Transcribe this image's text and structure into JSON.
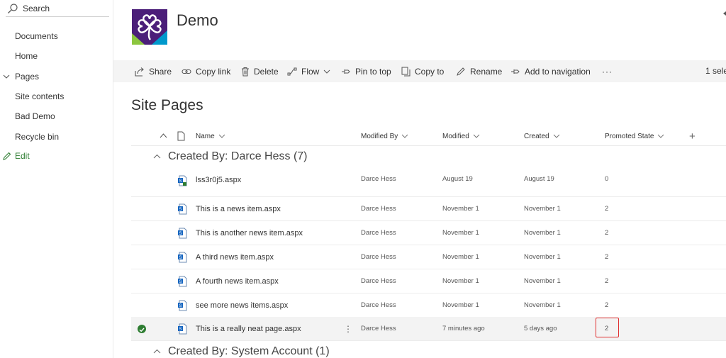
{
  "nav": {
    "search_label": "Search",
    "items": [
      "Documents",
      "Home",
      "Pages",
      "Site contents",
      "Bad Demo",
      "Recycle bin"
    ],
    "edit_label": "Edit"
  },
  "site": {
    "title": "Demo"
  },
  "command_bar": {
    "share": "Share",
    "copy_link": "Copy link",
    "delete": "Delete",
    "flow": "Flow",
    "pin_to_top": "Pin to top",
    "copy_to": "Copy to",
    "rename": "Rename",
    "add_to_navigation": "Add to navigation",
    "more": "···",
    "selection_text": "1 sele"
  },
  "page_title": "Site Pages",
  "columns": {
    "name": "Name",
    "modified_by": "Modified By",
    "modified": "Modified",
    "created": "Created",
    "promoted_state": "Promoted State",
    "add": "+"
  },
  "groups": [
    {
      "label": "Created By: Darce Hess (7)"
    },
    {
      "label": "Created By: System Account (1)"
    }
  ],
  "rows": [
    {
      "name": "lss3r0j5.aspx",
      "modified_by": "Darce Hess",
      "modified": "August 19",
      "created": "August 19",
      "promoted": "0"
    },
    {
      "name": "This is a news item.aspx",
      "modified_by": "Darce Hess",
      "modified": "November 1",
      "created": "November 1",
      "promoted": "2"
    },
    {
      "name": "This is another news item.aspx",
      "modified_by": "Darce Hess",
      "modified": "November 1",
      "created": "November 1",
      "promoted": "2"
    },
    {
      "name": "A third news item.aspx",
      "modified_by": "Darce Hess",
      "modified": "November 1",
      "created": "November 1",
      "promoted": "2"
    },
    {
      "name": "A fourth news item.aspx",
      "modified_by": "Darce Hess",
      "modified": "November 1",
      "created": "November 1",
      "promoted": "2"
    },
    {
      "name": "see more news items.aspx",
      "modified_by": "Darce Hess",
      "modified": "November 1",
      "created": "November 1",
      "promoted": "2"
    },
    {
      "name": "This is a really neat page.aspx",
      "modified_by": "Darce Hess",
      "modified": "7 minutes ago",
      "created": "5 days ago",
      "promoted": "2",
      "selected": true
    }
  ],
  "colors": {
    "accent": "#2e7d32",
    "highlight": "#e03030",
    "logo_bg": "#4b1e79"
  }
}
